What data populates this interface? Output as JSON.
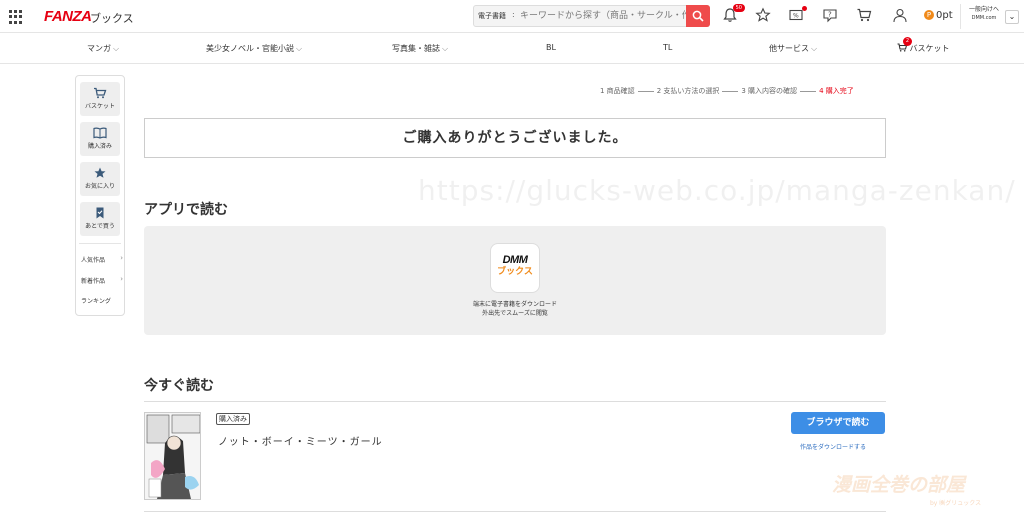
{
  "header": {
    "logo": "FANZA",
    "logo_sub": "ブックス",
    "search": {
      "category": "電子書籍",
      "placeholder": "キーワードから探す（商品・サークル・作者）"
    },
    "notification_count": "50",
    "points": "0pt",
    "general_site": {
      "line1": "一般向けへ",
      "line2": "DMM.com"
    }
  },
  "category_nav": {
    "items": [
      "マンガ",
      "美少女ノベル・官能小説",
      "写真集・雑誌",
      "BL",
      "TL",
      "他サービス"
    ],
    "basket_label": "バスケット",
    "basket_count": "2"
  },
  "sidebar": {
    "buttons": [
      "バスケット",
      "購入済み",
      "お気に入り",
      "あとで買う"
    ],
    "links": [
      "人気作品",
      "新着作品",
      "ランキング"
    ]
  },
  "steps": [
    "1 商品確認",
    "2 支払い方法の選択",
    "3 購入内容の確認",
    "4 購入完了"
  ],
  "thanks": "ご購入ありがとうございました。",
  "app_section": {
    "title": "アプリで読む",
    "logo_line1": "DMM",
    "logo_line2": "ブックス",
    "desc1": "端末に電子書籍をダウンロード",
    "desc2": "外出先でスムーズに閲覧"
  },
  "read_now": {
    "title": "今すぐ読む",
    "badge": "購入済み",
    "book_title": "ノット・ボーイ・ミーツ・ガール",
    "browser_button": "ブラウザで読む",
    "download_link": "作品をダウンロードする"
  },
  "watermarks": {
    "url": "https://glucks-web.co.jp/manga-zenkan/",
    "logo": "漫画全巻の部屋",
    "logo_sub": "by ㈱グリュックス"
  },
  "colors": {
    "brand_red": "#e60012",
    "button_blue": "#3d8ee6",
    "points_orange": "#f08a1a"
  }
}
